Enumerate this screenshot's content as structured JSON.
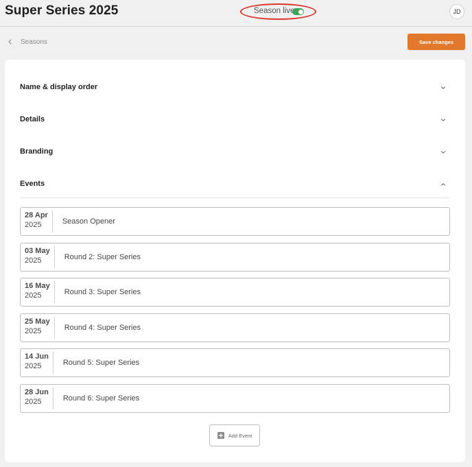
{
  "header": {
    "title": "Super Series 2025",
    "live_label": "Season live",
    "live_enabled": true,
    "avatar_initials": "JD"
  },
  "nav": {
    "back_label": "Seasons",
    "save_label": "Save changes"
  },
  "sections": [
    {
      "title": "Name & display order",
      "expanded": false,
      "icon": "chevron-down-icon"
    },
    {
      "title": "Details",
      "expanded": false,
      "icon": "chevron-down-icon"
    },
    {
      "title": "Branding",
      "expanded": false,
      "icon": "chevron-down-icon"
    },
    {
      "title": "Events",
      "expanded": true,
      "icon": "chevron-up-icon"
    }
  ],
  "events": [
    {
      "day": "28 Apr",
      "year": "2025",
      "name": "Season Opener"
    },
    {
      "day": "03 May",
      "year": "2025",
      "name": "Round 2: Super Series"
    },
    {
      "day": "16 May",
      "year": "2025",
      "name": "Round 3: Super Series"
    },
    {
      "day": "25 May",
      "year": "2025",
      "name": "Round 4: Super Series"
    },
    {
      "day": "14 Jun",
      "year": "2025",
      "name": "Round 5: Super Series"
    },
    {
      "day": "28 Jun",
      "year": "2025",
      "name": "Round 6: Super Series"
    }
  ],
  "add_event_label": "Add Event",
  "colors": {
    "accent": "#e2782a",
    "toggle_on": "#3aa655",
    "highlight_ring": "#d9352b"
  }
}
